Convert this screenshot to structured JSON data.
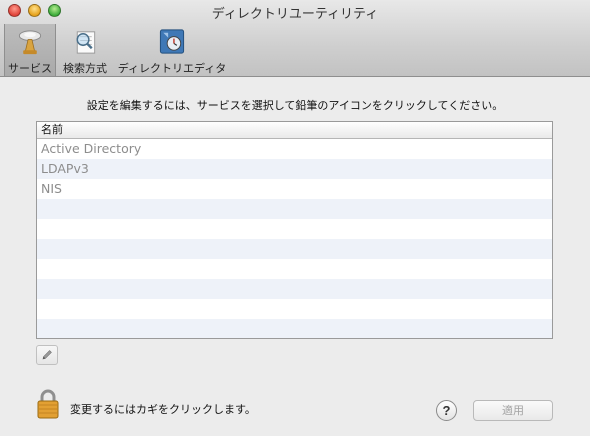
{
  "window": {
    "title": "ディレクトリユーティリティ"
  },
  "toolbar": {
    "items": [
      {
        "label": "サービス",
        "icon": "services-icon",
        "selected": true
      },
      {
        "label": "検索方式",
        "icon": "search-policy-icon",
        "selected": false
      },
      {
        "label": "ディレクトリエディタ",
        "icon": "directory-editor-icon",
        "selected": false
      }
    ]
  },
  "main": {
    "instruction": "設定を編集するには、サービスを選択して鉛筆のアイコンをクリックしてください。",
    "table": {
      "column_header": "名前",
      "rows": [
        "Active Directory",
        "LDAPv3",
        "NIS"
      ]
    }
  },
  "footer": {
    "lock_text": "変更するにはカギをクリックします。",
    "help_label": "?",
    "apply_label": "適用"
  }
}
